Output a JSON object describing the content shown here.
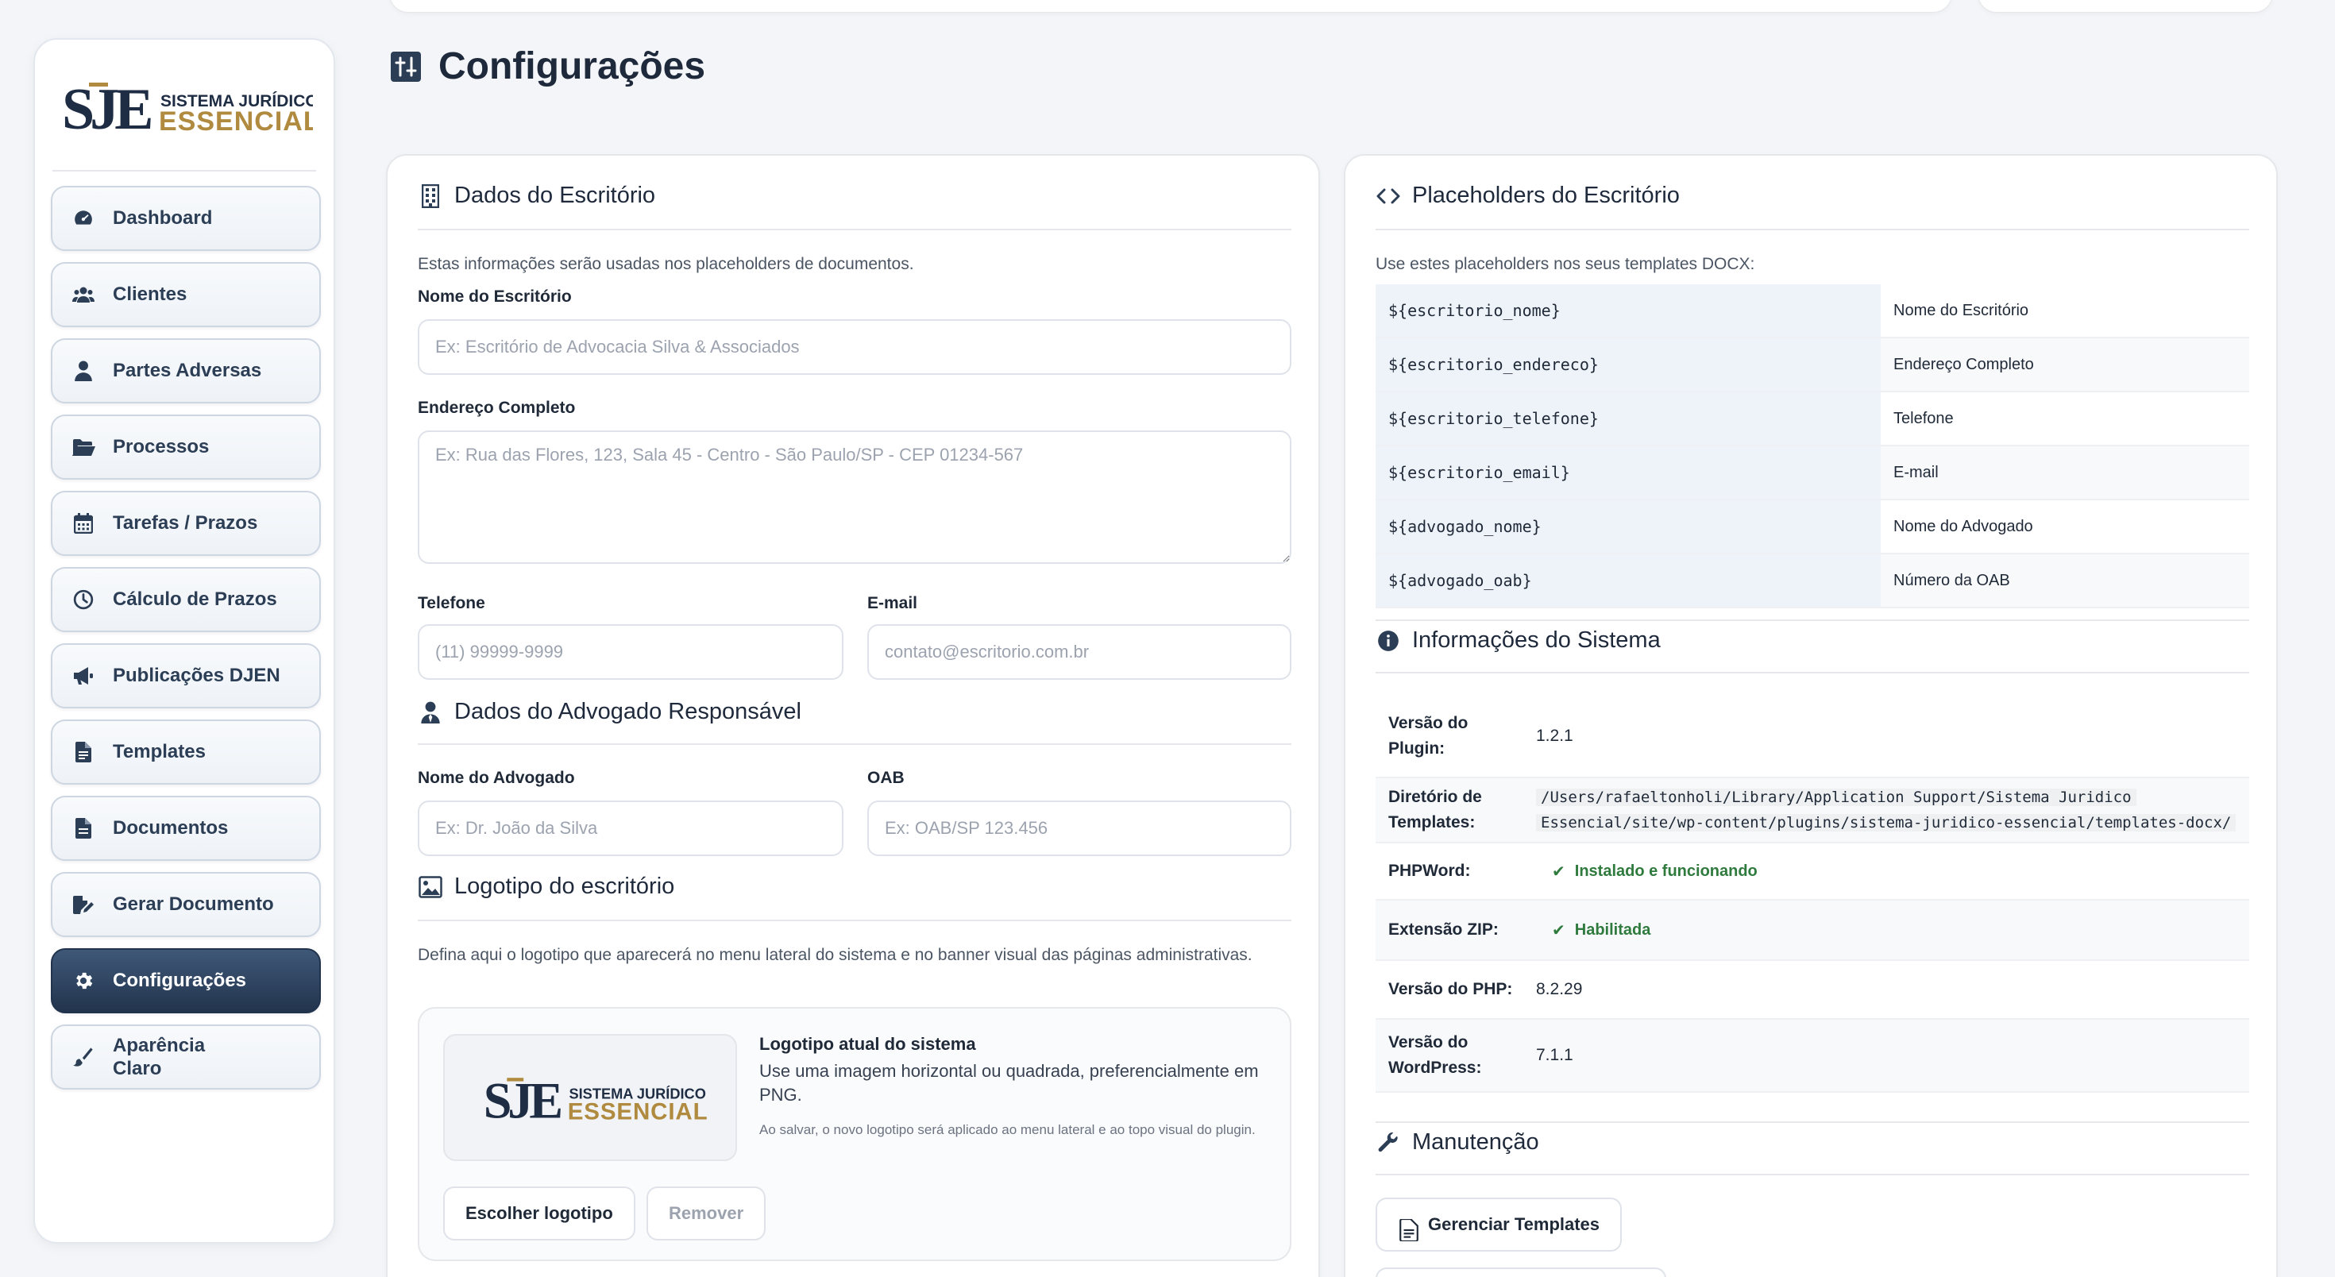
{
  "brand": {
    "line1": "SISTEMA JURÍDICO",
    "line2": "ESSENCIAL",
    "mark": "SJE"
  },
  "sidebar": {
    "items": [
      {
        "label": "Dashboard",
        "icon": "gauge-icon"
      },
      {
        "label": "Clientes",
        "icon": "users-icon"
      },
      {
        "label": "Partes Adversas",
        "icon": "user-icon"
      },
      {
        "label": "Processos",
        "icon": "folder-open-icon"
      },
      {
        "label": "Tarefas / Prazos",
        "icon": "calendar-icon"
      },
      {
        "label": "Cálculo de Prazos",
        "icon": "clock-icon"
      },
      {
        "label": "Publicações DJEN",
        "icon": "megaphone-icon"
      },
      {
        "label": "Templates",
        "icon": "file-lines-icon"
      },
      {
        "label": "Documentos",
        "icon": "file-icon"
      },
      {
        "label": "Gerar Documento",
        "icon": "file-pen-icon"
      },
      {
        "label": "Configurações",
        "icon": "gear-icon",
        "active": true
      }
    ],
    "appearance": {
      "label": "Aparência",
      "value": "Claro",
      "icon": "brush-icon"
    }
  },
  "page": {
    "title": "Configurações"
  },
  "office": {
    "title": "Dados do Escritório",
    "description": "Estas informações serão usadas nos placeholders de documentos.",
    "name_label": "Nome do Escritório",
    "name_placeholder": "Ex: Escritório de Advocacia Silva & Associados",
    "address_label": "Endereço Completo",
    "address_placeholder": "Ex: Rua das Flores, 123, Sala 45 - Centro - São Paulo/SP - CEP 01234-567",
    "phone_label": "Telefone",
    "phone_placeholder": "(11) 99999-9999",
    "email_label": "E-mail",
    "email_placeholder": "contato@escritorio.com.br"
  },
  "lawyer": {
    "title": "Dados do Advogado Responsável",
    "name_label": "Nome do Advogado",
    "name_placeholder": "Ex: Dr. João da Silva",
    "oab_label": "OAB",
    "oab_placeholder": "Ex: OAB/SP 123.456"
  },
  "logo_section": {
    "title": "Logotipo do escritório",
    "description": "Defina aqui o logotipo que aparecerá no menu lateral do sistema e no banner visual das páginas administrativas.",
    "current_title": "Logotipo atual do sistema",
    "current_text": "Use uma imagem horizontal ou quadrada, preferencialmente em PNG.",
    "current_note": "Ao salvar, o novo logotipo será aplicado ao menu lateral e ao topo visual do plugin.",
    "choose_label": "Escolher logotipo",
    "remove_label": "Remover"
  },
  "placeholders": {
    "title": "Placeholders do Escritório",
    "description": "Use estes placeholders nos seus templates DOCX:",
    "rows": [
      {
        "code": "${escritorio_nome}",
        "desc": "Nome do Escritório"
      },
      {
        "code": "${escritorio_endereco}",
        "desc": "Endereço Completo"
      },
      {
        "code": "${escritorio_telefone}",
        "desc": "Telefone"
      },
      {
        "code": "${escritorio_email}",
        "desc": "E-mail"
      },
      {
        "code": "${advogado_nome}",
        "desc": "Nome do Advogado"
      },
      {
        "code": "${advogado_oab}",
        "desc": "Número da OAB"
      }
    ]
  },
  "system_info": {
    "title": "Informações do Sistema",
    "plugin_version_label_1": "Versão do",
    "plugin_version_label_2": "Plugin:",
    "plugin_version": "1.2.1",
    "templates_dir_label_1": "Diretório de",
    "templates_dir_label_2": "Templates:",
    "templates_dir_1": "/Users/rafaeltonholi/Library/Application Support/Sistema Juridico",
    "templates_dir_2": "Essencial/site/wp-content/plugins/sistema-juridico-essencial/templates-docx/",
    "phpword_label": "PHPWord:",
    "phpword_status": "Instalado e funcionando",
    "zip_label": "Extensão ZIP:",
    "zip_status": "Habilitada",
    "php_label": "Versão do PHP:",
    "php_version": "8.2.29",
    "wp_label_1": "Versão do",
    "wp_label_2": "WordPress:",
    "wp_version": "7.1.1",
    "status_color": "#2f7a3d"
  },
  "maintenance": {
    "title": "Manutenção",
    "manage_templates_label": "Gerenciar Templates"
  }
}
